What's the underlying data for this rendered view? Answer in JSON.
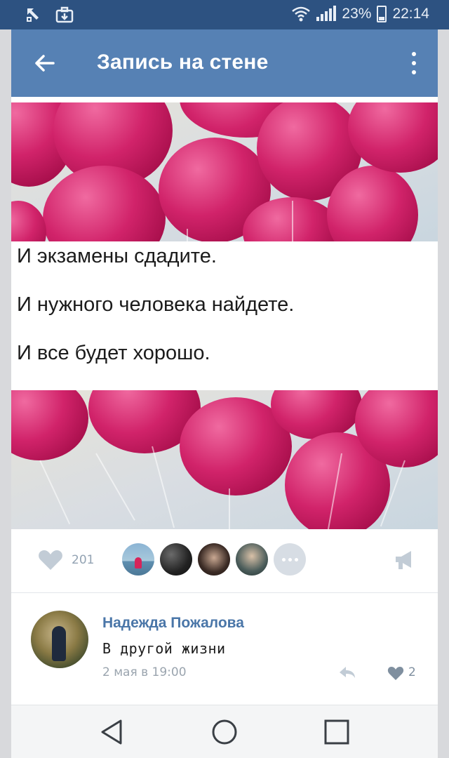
{
  "statusbar": {
    "battery": "23%",
    "time": "22:14"
  },
  "appbar": {
    "title": "Запись на стене"
  },
  "post": {
    "image_text": [
      "И экзамены сдадите.",
      "И нужного человека найдете.",
      "И все будет хорошо."
    ],
    "likes_count": "201"
  },
  "comment": {
    "author": "Надежда Пожалова",
    "text": "В другой жизни",
    "date": "2 мая в 19:00",
    "likes": "2"
  },
  "colors": {
    "statusbar": "#2d5281",
    "appbar": "#5681b4",
    "link": "#4a76a8",
    "balloon": "#d1236a"
  },
  "icons": {
    "status_left": [
      "sync-icon",
      "briefcase-icon"
    ],
    "status_right": [
      "wifi-icon",
      "signal-icon",
      "battery-icon"
    ],
    "appbar": [
      "back-arrow-icon",
      "more-vertical-icon"
    ],
    "post": [
      "heart-icon",
      "more-dots-icon",
      "megaphone-icon"
    ],
    "comment": [
      "reply-icon",
      "heart-icon"
    ],
    "navbar": [
      "triangle-back-icon",
      "circle-home-icon",
      "square-recent-icon"
    ]
  }
}
